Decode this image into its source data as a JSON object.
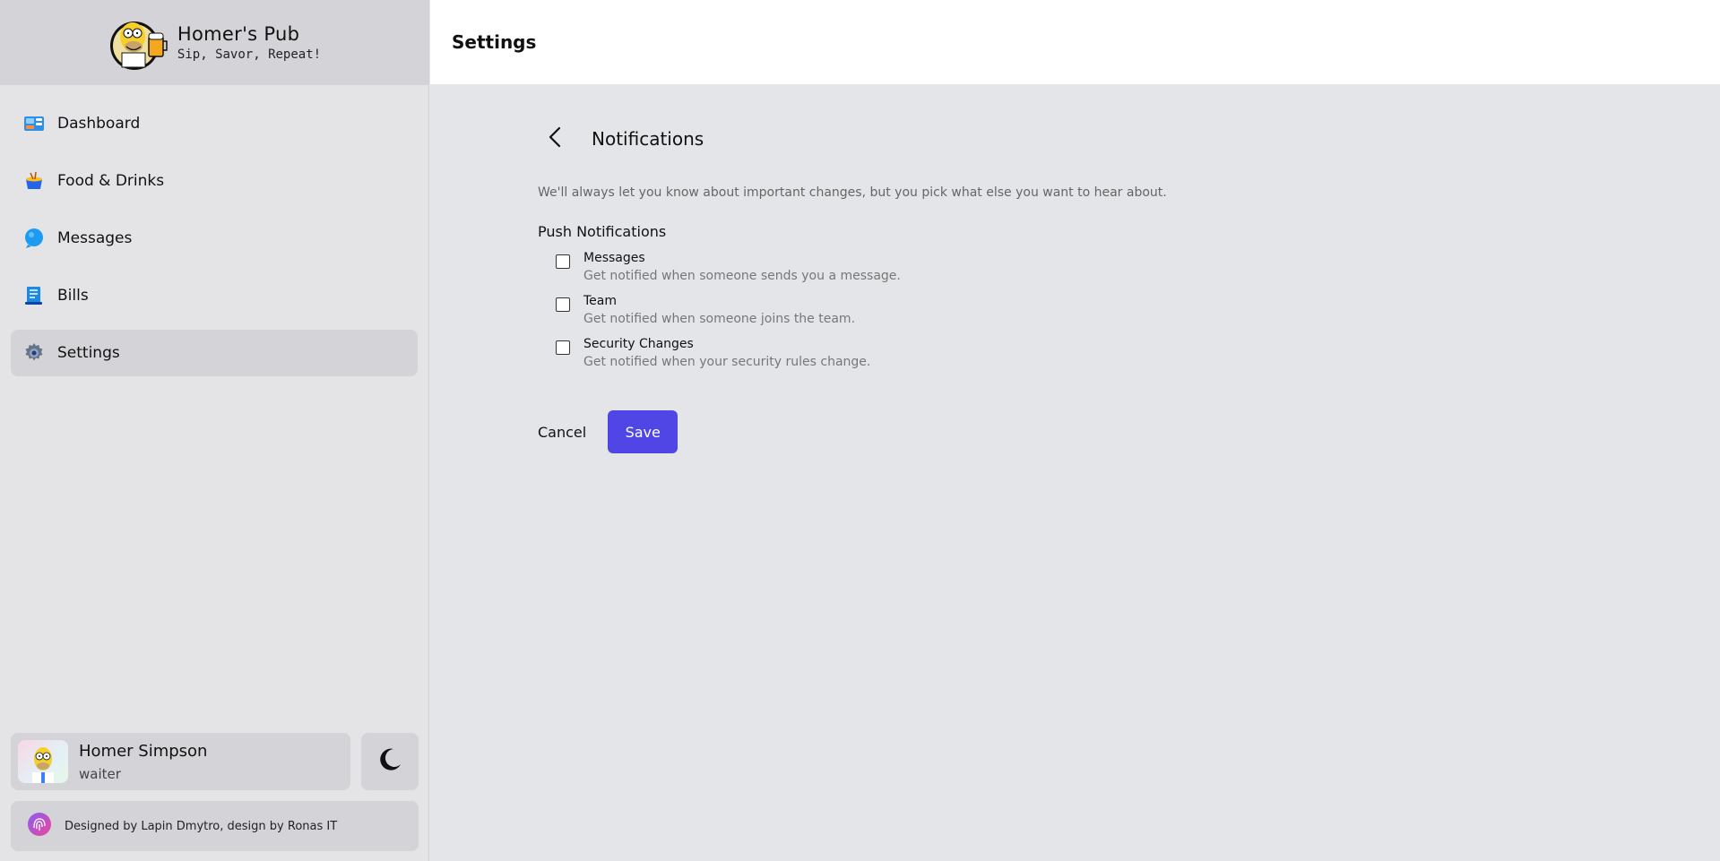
{
  "brand": {
    "title": "Homer's Pub",
    "subtitle": "Sip, Savor, Repeat!"
  },
  "header": {
    "title": "Settings"
  },
  "sidebar": {
    "items": [
      {
        "label": "Dashboard",
        "icon": "dashboard-icon",
        "active": false
      },
      {
        "label": "Food & Drinks",
        "icon": "food-icon",
        "active": false
      },
      {
        "label": "Messages",
        "icon": "messages-icon",
        "active": false
      },
      {
        "label": "Bills",
        "icon": "bills-icon",
        "active": false
      },
      {
        "label": "Settings",
        "icon": "gear-icon",
        "active": true
      }
    ]
  },
  "user": {
    "name": "Homer Simpson",
    "role": "waiter"
  },
  "credits": {
    "text": "Designed by Lapin Dmytro, design by Ronas IT"
  },
  "notifications": {
    "title": "Notifications",
    "description": "We'll always let you know about important changes, but you pick what else you want to hear about.",
    "section_title": "Push Notifications",
    "options": [
      {
        "label": "Messages",
        "description": "Get notified when someone sends you a message.",
        "checked": false
      },
      {
        "label": "Team",
        "description": "Get notified when someone joins the team.",
        "checked": false
      },
      {
        "label": "Security Changes",
        "description": "Get notified when your security rules change.",
        "checked": false
      }
    ],
    "cancel_label": "Cancel",
    "save_label": "Save"
  },
  "colors": {
    "accent": "#4f46e5",
    "sidebar_bg": "#e4e4e7",
    "active_bg": "#d4d4d8"
  }
}
